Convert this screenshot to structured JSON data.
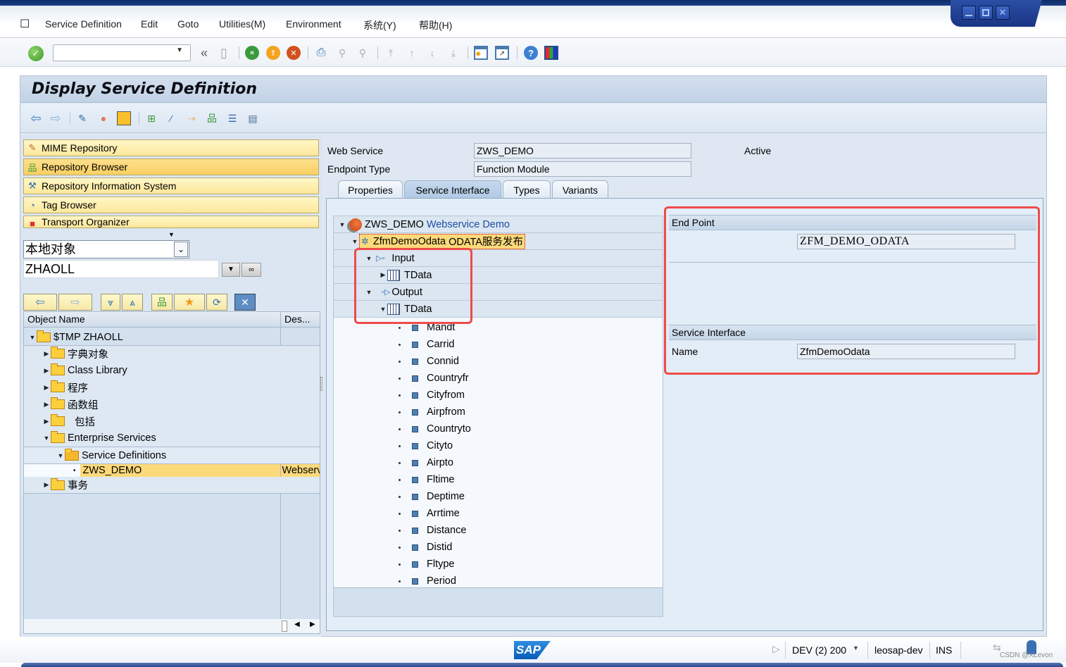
{
  "menu": {
    "items": [
      {
        "label": "Service Definition"
      },
      {
        "label": "Edit"
      },
      {
        "label": "Goto"
      },
      {
        "label": "Utilities(M)"
      },
      {
        "label": "Environment"
      },
      {
        "label": "系统(Y)"
      },
      {
        "label": "帮助(H)"
      }
    ]
  },
  "toolbar": {
    "command_field_value": "",
    "icons": [
      "enter-icon",
      "save-icon",
      "back-icon",
      "exit-icon",
      "cancel-icon",
      "print-icon",
      "find-icon",
      "find-next-icon",
      "first-page-icon",
      "previous-page-icon",
      "next-page-icon",
      "last-page-icon",
      "new-session-icon",
      "shortcut-icon",
      "help-icon",
      "customize-layout-icon"
    ]
  },
  "title": "Display Service Definition",
  "app_toolbar": {
    "icons": [
      "back-arrow-icon",
      "forward-arrow-icon",
      "display-change-icon",
      "active-inactive-icon",
      "other-object-icon",
      "where-used-icon",
      "wizard-icon",
      "navigate-icon",
      "object-list-icon",
      "hierarchy-icon",
      "layout-icon"
    ]
  },
  "left": {
    "nav_buttons": [
      {
        "label": "MIME Repository",
        "icon": "mime-icon"
      },
      {
        "label": "Repository Browser",
        "icon": "hierarchy-icon",
        "active": true
      },
      {
        "label": "Repository Information System",
        "icon": "tools-icon"
      },
      {
        "label": "Tag Browser",
        "icon": "tag-icon"
      },
      {
        "label": "Transport Organizer",
        "icon": "truck-icon"
      }
    ],
    "object_type_select": "本地对象",
    "user_input": "ZHAOLL",
    "tree_header": {
      "col1": "Object Name",
      "col2": "Des..."
    },
    "tree": [
      {
        "label": "$TMP ZHAOLL",
        "level": 0,
        "expanded": true,
        "desc": ""
      },
      {
        "label": "字典对象",
        "level": 1,
        "expanded": false,
        "desc": ""
      },
      {
        "label": "Class Library",
        "level": 1,
        "expanded": false,
        "desc": ""
      },
      {
        "label": "程序",
        "level": 1,
        "expanded": false,
        "desc": ""
      },
      {
        "label": "函数组",
        "level": 1,
        "expanded": false,
        "desc": ""
      },
      {
        "label": "包括",
        "level": 1,
        "expanded": false,
        "desc": ""
      },
      {
        "label": "Enterprise Services",
        "level": 1,
        "expanded": true,
        "desc": ""
      },
      {
        "label": "Service Definitions",
        "level": 2,
        "expanded": true,
        "desc": ""
      },
      {
        "label": "ZWS_DEMO",
        "level": 3,
        "selected": true,
        "desc": "Webserv"
      },
      {
        "label": "事务",
        "level": 1,
        "expanded": false,
        "desc": ""
      }
    ]
  },
  "header": {
    "web_service_label": "Web Service",
    "web_service_value": "ZWS_DEMO",
    "status": "Active",
    "endpoint_type_label": "Endpoint Type",
    "endpoint_type_value": "Function Module"
  },
  "tabs": [
    {
      "label": "Properties"
    },
    {
      "label": "Service Interface",
      "active": true
    },
    {
      "label": "Types"
    },
    {
      "label": "Variants"
    }
  ],
  "service_tree": {
    "root": {
      "name": "ZWS_DEMO",
      "desc": "Webservice Demo"
    },
    "operation": {
      "name": "ZfmDemoOdata",
      "desc": "ODATA服务发布"
    },
    "input": "Input",
    "input_table": "TData",
    "output": "Output",
    "output_table": "TData",
    "fields": [
      "Mandt",
      "Carrid",
      "Connid",
      "Countryfr",
      "Cityfrom",
      "Airpfrom",
      "Countryto",
      "Cityto",
      "Airpto",
      "Fltime",
      "Deptime",
      "Arrtime",
      "Distance",
      "Distid",
      "Fltype",
      "Period"
    ]
  },
  "detail": {
    "end_point_title": "End Point",
    "end_point_value": "ZFM_DEMO_ODATA",
    "service_interface_title": "Service Interface",
    "name_label": "Name",
    "name_value": "ZfmDemoOdata"
  },
  "status_bar": {
    "logo": "SAP",
    "system": "DEV (2) 200",
    "host": "leosap-dev",
    "mode": "INS",
    "watermark": "CSDN @XLevon"
  },
  "colors": {
    "highlight_red": "#ef4b4b",
    "selection_yellow": "#fcd97a",
    "sap_blue": "#1a3f8a"
  }
}
